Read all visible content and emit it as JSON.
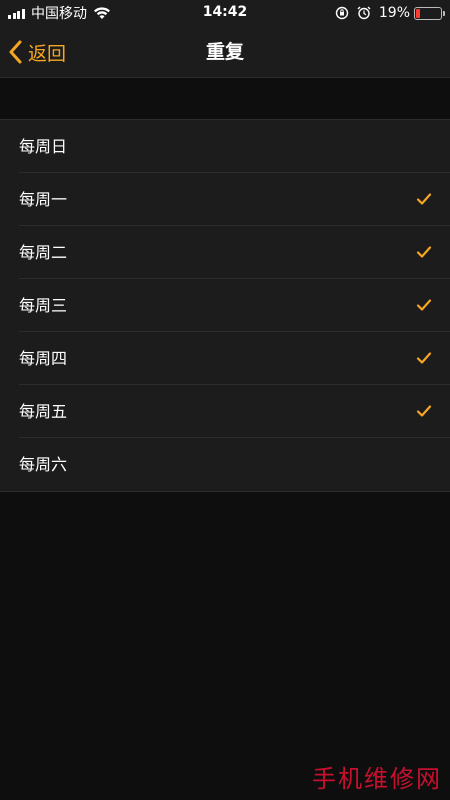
{
  "status_bar": {
    "carrier": "中国移动",
    "time": "14:42",
    "battery_percent": "19%",
    "battery_level": 0.19,
    "battery_color": "#ff3b30",
    "icons": [
      "signal-icon",
      "wifi-icon",
      "orientation-lock-icon",
      "alarm-icon",
      "battery-icon"
    ]
  },
  "nav": {
    "back_label": "返回",
    "title": "重复",
    "accent_color": "#f5a623"
  },
  "days": [
    {
      "label": "每周日",
      "checked": false
    },
    {
      "label": "每周一",
      "checked": true
    },
    {
      "label": "每周二",
      "checked": true
    },
    {
      "label": "每周三",
      "checked": true
    },
    {
      "label": "每周四",
      "checked": true
    },
    {
      "label": "每周五",
      "checked": true
    },
    {
      "label": "每周六",
      "checked": false
    }
  ],
  "watermark": "手机维修网"
}
